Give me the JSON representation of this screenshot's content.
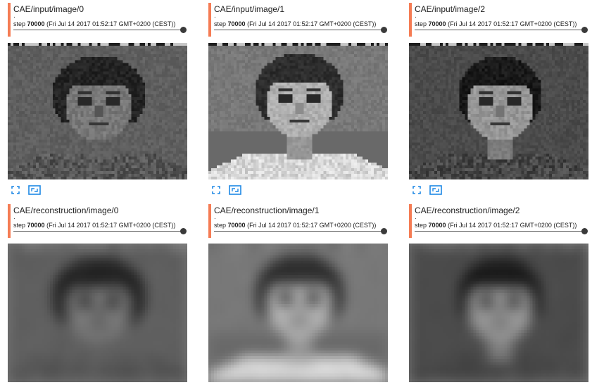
{
  "accent_color": "#f57c54",
  "icon_color": "#1e88e5",
  "cards": [
    {
      "title": "CAE/input/image/0",
      "dot": ".",
      "step_label": "step",
      "step_value": "70000",
      "timestamp": "(Fri Jul 14 2017 01:52:17 GMT+0200 (CEST))",
      "image_desc": "input-face-0",
      "blur": false,
      "controls": [
        "fit-to-screen-icon",
        "expand-icon"
      ]
    },
    {
      "title": "CAE/input/image/1",
      "dot": ".",
      "step_label": "step",
      "step_value": "70000",
      "timestamp": "(Fri Jul 14 2017 01:52:17 GMT+0200 (CEST))",
      "image_desc": "input-face-1",
      "blur": false,
      "controls": [
        "fit-to-screen-icon",
        "expand-icon"
      ]
    },
    {
      "title": "CAE/input/image/2",
      "dot": ".",
      "step_label": "step",
      "step_value": "70000",
      "timestamp": "(Fri Jul 14 2017 01:52:17 GMT+0200 (CEST))",
      "image_desc": "input-face-2",
      "blur": false,
      "controls": [
        "fit-to-screen-icon",
        "expand-icon"
      ]
    },
    {
      "title": "CAE/reconstruction/image/0",
      "dot": ".",
      "step_label": "step",
      "step_value": "70000",
      "timestamp": "(Fri Jul 14 2017 01:52:17 GMT+0200 (CEST))",
      "image_desc": "reconstruction-face-0",
      "blur": true,
      "controls": []
    },
    {
      "title": "CAE/reconstruction/image/1",
      "dot": ".",
      "step_label": "step",
      "step_value": "70000",
      "timestamp": "(Fri Jul 14 2017 01:52:17 GMT+0200 (CEST))",
      "image_desc": "reconstruction-face-1",
      "blur": true,
      "controls": []
    },
    {
      "title": "CAE/reconstruction/image/2",
      "dot": ".",
      "step_label": "step",
      "step_value": "70000",
      "timestamp": "(Fri Jul 14 2017 01:52:17 GMT+0200 (CEST))",
      "image_desc": "reconstruction-face-2",
      "blur": true,
      "controls": []
    }
  ]
}
